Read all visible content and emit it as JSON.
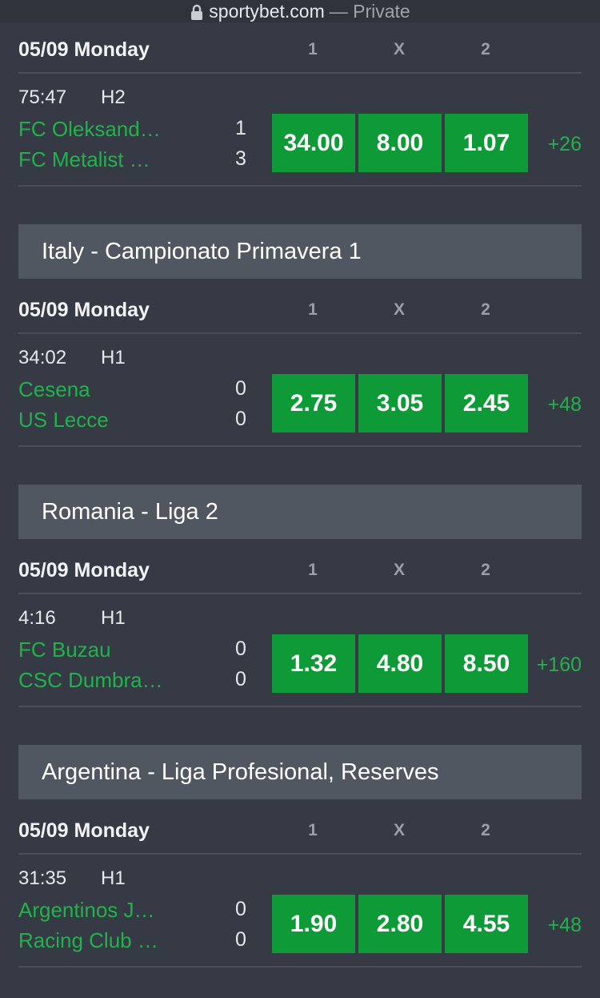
{
  "browser": {
    "host": "sportybet.com",
    "mode": "— Private"
  },
  "columns": {
    "c1": "1",
    "cx": "X",
    "c2": "2"
  },
  "sections": [
    {
      "league": "",
      "date": "05/09 Monday",
      "match": {
        "time": "75:47",
        "half": "H2",
        "home": "FC Oleksand…",
        "away": "FC Metalist …",
        "home_score": "1",
        "away_score": "3",
        "odds": [
          "34.00",
          "8.00",
          "1.07"
        ],
        "more": "+26"
      }
    },
    {
      "league": "Italy - Campionato Primavera 1",
      "date": "05/09 Monday",
      "match": {
        "time": "34:02",
        "half": "H1",
        "home": "Cesena",
        "away": "US Lecce",
        "home_score": "0",
        "away_score": "0",
        "odds": [
          "2.75",
          "3.05",
          "2.45"
        ],
        "more": "+48"
      }
    },
    {
      "league": "Romania - Liga 2",
      "date": "05/09 Monday",
      "match": {
        "time": "4:16",
        "half": "H1",
        "home": "FC Buzau",
        "away": "CSC Dumbra…",
        "home_score": "0",
        "away_score": "0",
        "odds": [
          "1.32",
          "4.80",
          "8.50"
        ],
        "more": "+160"
      }
    },
    {
      "league": "Argentina - Liga Profesional, Reserves",
      "date": "05/09 Monday",
      "match": {
        "time": "31:35",
        "half": "H1",
        "home": "Argentinos J…",
        "away": "Racing Club …",
        "home_score": "0",
        "away_score": "0",
        "odds": [
          "1.90",
          "2.80",
          "4.55"
        ],
        "more": "+48"
      }
    }
  ],
  "colors": {
    "background": "#353a45",
    "league_bar": "#515761",
    "odds_button": "#0e9a36",
    "team_text": "#21b34a"
  },
  "icons": {
    "lock": "lock-icon"
  }
}
